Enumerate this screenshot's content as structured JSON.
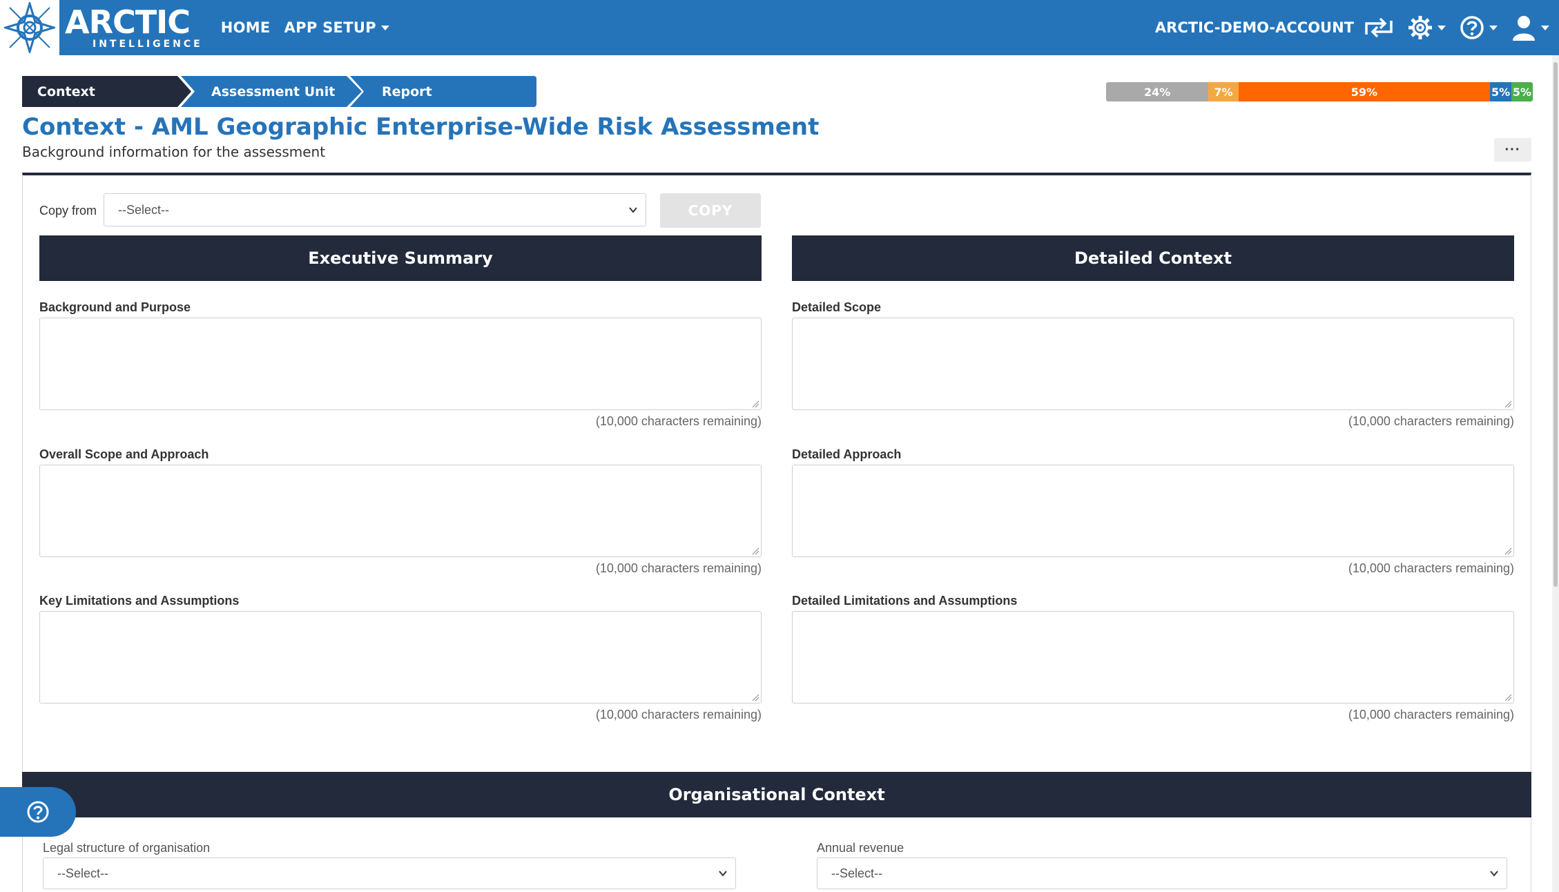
{
  "navbar": {
    "brand_main": "ARCTIC",
    "brand_sub": "INTELLIGENCE",
    "home_label": "HOME",
    "app_setup_label": "APP SETUP",
    "account_label": "ARCTIC-DEMO-ACCOUNT",
    "icons": [
      "switch-account-icon",
      "gear-icon",
      "help-icon",
      "user-icon"
    ]
  },
  "steps": [
    {
      "label": "Context",
      "active": true
    },
    {
      "label": "Assessment Unit",
      "active": false
    },
    {
      "label": "Report",
      "active": false
    }
  ],
  "progress": [
    {
      "label": "24%",
      "value": 24,
      "color": "#a9a9a9"
    },
    {
      "label": "7%",
      "value": 7,
      "color": "#f5a742"
    },
    {
      "label": "59%",
      "value": 59,
      "color": "#ff6600"
    },
    {
      "label": "5%",
      "value": 5,
      "color": "#2574b9"
    },
    {
      "label": "5%",
      "value": 5,
      "color": "#4cae4c"
    }
  ],
  "page": {
    "title": "Context - AML Geographic Enterprise-Wide Risk Assessment",
    "subtitle": "Background information for the assessment",
    "more_label": "···"
  },
  "copy_from": {
    "label": "Copy from",
    "select_value": "--Select--",
    "button_label": "COPY"
  },
  "executive_summary": {
    "heading": "Executive Summary",
    "fields": [
      {
        "label": "Background and Purpose",
        "remaining": "(10,000 characters remaining)"
      },
      {
        "label": "Overall Scope and Approach",
        "remaining": "(10,000 characters remaining)"
      },
      {
        "label": "Key Limitations and Assumptions",
        "remaining": "(10,000 characters remaining)"
      }
    ]
  },
  "detailed_context": {
    "heading": "Detailed Context",
    "fields": [
      {
        "label": "Detailed Scope",
        "remaining": "(10,000 characters remaining)"
      },
      {
        "label": "Detailed Approach",
        "remaining": "(10,000 characters remaining)"
      },
      {
        "label": "Detailed Limitations and Assumptions",
        "remaining": "(10,000 characters remaining)"
      }
    ]
  },
  "organisational_context": {
    "heading": "Organisational Context",
    "legal_structure_label": "Legal structure of organisation",
    "legal_structure_value": "--Select--",
    "annual_revenue_label": "Annual revenue",
    "annual_revenue_value": "--Select--"
  },
  "colors": {
    "brand_blue": "#2574b9",
    "dark_navy": "#222a3b"
  }
}
